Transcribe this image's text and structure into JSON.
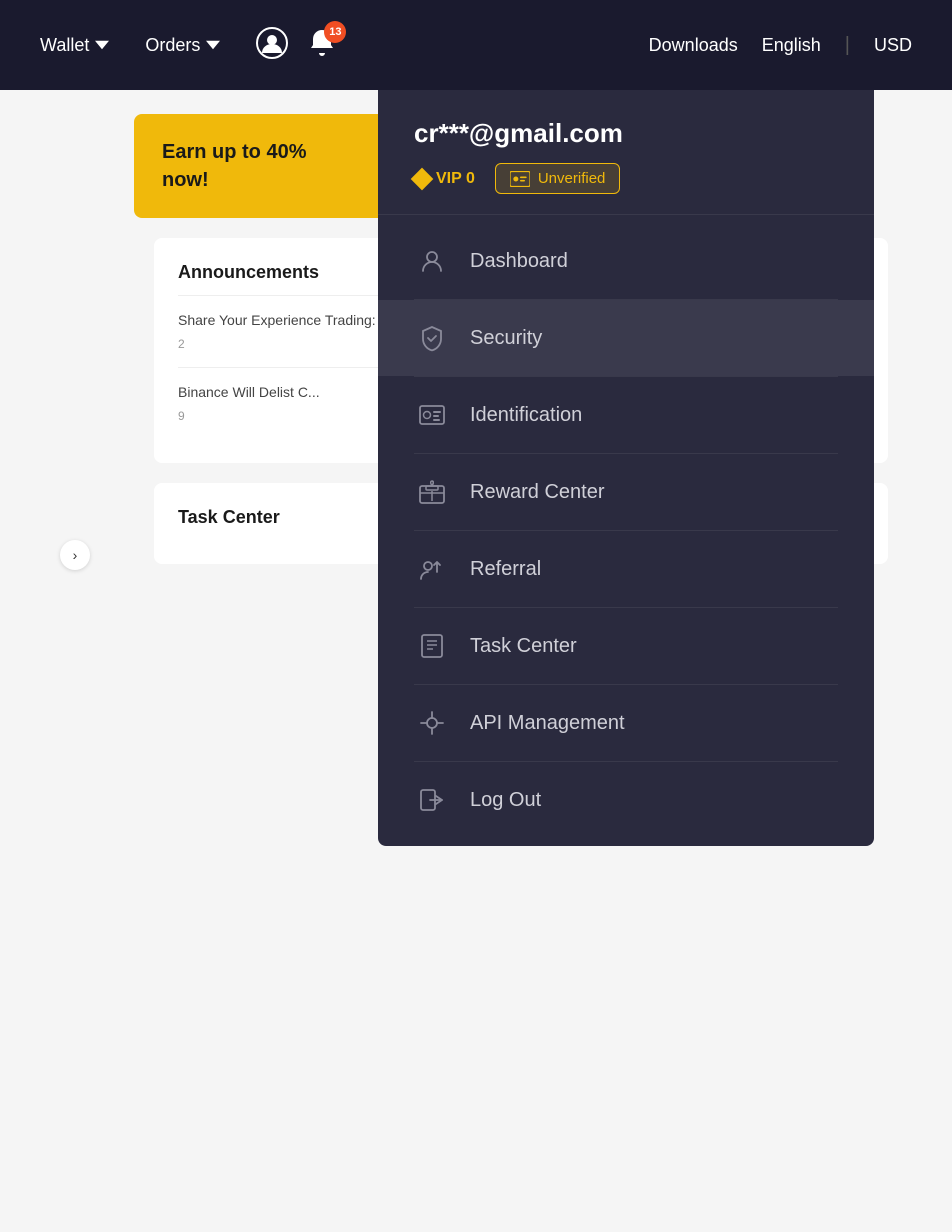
{
  "navbar": {
    "wallet_label": "Wallet",
    "orders_label": "Orders",
    "downloads_label": "Downloads",
    "english_label": "English",
    "usd_label": "USD",
    "notification_count": "13"
  },
  "dropdown": {
    "email": "cr***@gmail.com",
    "vip_label": "VIP 0",
    "unverified_label": "Unverified",
    "items": [
      {
        "label": "Dashboard",
        "icon": "dashboard-icon",
        "id": "dashboard"
      },
      {
        "label": "Security",
        "icon": "security-icon",
        "id": "security"
      },
      {
        "label": "Identification",
        "icon": "identification-icon",
        "id": "identification"
      },
      {
        "label": "Reward Center",
        "icon": "reward-icon",
        "id": "reward-center"
      },
      {
        "label": "Referral",
        "icon": "referral-icon",
        "id": "referral"
      },
      {
        "label": "Task Center",
        "icon": "task-icon",
        "id": "task-center"
      },
      {
        "label": "API Management",
        "icon": "api-icon",
        "id": "api-management"
      },
      {
        "label": "Log Out",
        "icon": "logout-icon",
        "id": "logout"
      }
    ]
  },
  "page": {
    "promo_text": "Earn up to 40%\nnow!",
    "chevron": ">",
    "announcements_title": "Announcements",
    "announcement_1": "Share Your Experience Trading: Limited Ed...",
    "announcement_1_meta": "2",
    "announcement_2": "Binance Will Delist C...",
    "announcement_2_meta": "9",
    "task_center_title": "Task Center"
  }
}
